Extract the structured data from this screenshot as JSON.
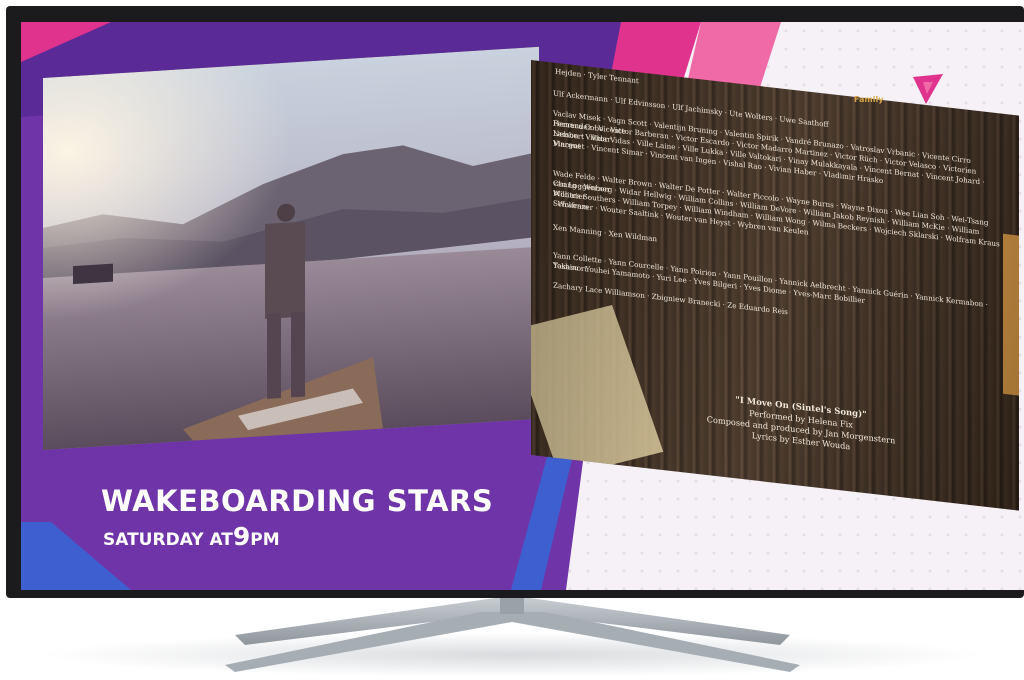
{
  "promo": {
    "title": "WAKEBOARDING STARS",
    "day_text": "SATURDAY AT",
    "hour": "9",
    "suffix": "PM"
  },
  "channel": {
    "label": "Family"
  },
  "credits": {
    "top_partial": "Hejden · Tyler Tennant",
    "lines": [
      "Ulf Ackermann · Ulf Edvinsson · Ulf Jachimsky · Ute Wolters · Uwe Saathoff",
      "Vaclav Misek · Vagn Scott · Valentijn Bruning · Valentin Spirik · Vandré Brunazo · Vatroslav Vrbanic · Vicente Cirro Fernandez · Vicente",
      "Herrera Cobo · Victor Barberan · Victor Escardo · Victor Madarro Martinez · Victor Rüch · Victor Velasco · Victorien Lambert · Vidar",
      "Nelson · Viktor Vidas · Ville Laine · Ville Lukka · Ville Valtokari · Vinay Mulakkayala · Vincent Bernat · Vincent Johard · Vincent",
      "Marguet · Vincent Simar · Vincent van Ingen · Vishal Rao · Vivian Haber · Vladimir Hrasko",
      "Wade Felde · Walter Brown · Walter De Potter · Walter Piccolo · Wayne Burns · Wayne Dixon · Wee Lian Soh · Wei-Tsang Chang · Werner",
      "van Loggenberg · Widar Hellwig · William Collins · William DeVore · William Jakob Reynish · William McKie · William Montrier ·",
      "William Southers · William Torpey · William Windham · William Wong · Wilma Beckers · Wojciech Sklarski · Wolfram Kraus · Wolfram",
      "Schwenzer · Wouter Saaltink · Wouter van Heyst · Wybren van Keulen",
      "Xen Manning · Xen Wildman",
      "Yann Collette · Yann Courcelle · Yann Poirion · Yann Pouillon · Yannick Aelbrecht · Yannick Guérin · Yannick Kermabon · Yoshinori",
      "Takasu · Youhei Yamamoto · Yuri Lee · Yves Bilgeri · Yves Diome · Yves-Marc Bobillier",
      "Zachary Lace Williamson · Zbigniew Branecki · Ze Eduardo Reis"
    ],
    "song_title": "\"I Move On (Sintel's Song)\"",
    "song_lines": [
      "Performed by Helena Fix",
      "Composed and produced by Jan Morgenstern",
      "Lyrics by Esther Wouda"
    ]
  },
  "colors": {
    "purple": "#6f35a8",
    "dark_purple": "#4f2a8c",
    "magenta": "#e0338d",
    "pink": "#f06aa8",
    "blue": "#3e5fd0",
    "bezel": "#1b1b1d"
  }
}
